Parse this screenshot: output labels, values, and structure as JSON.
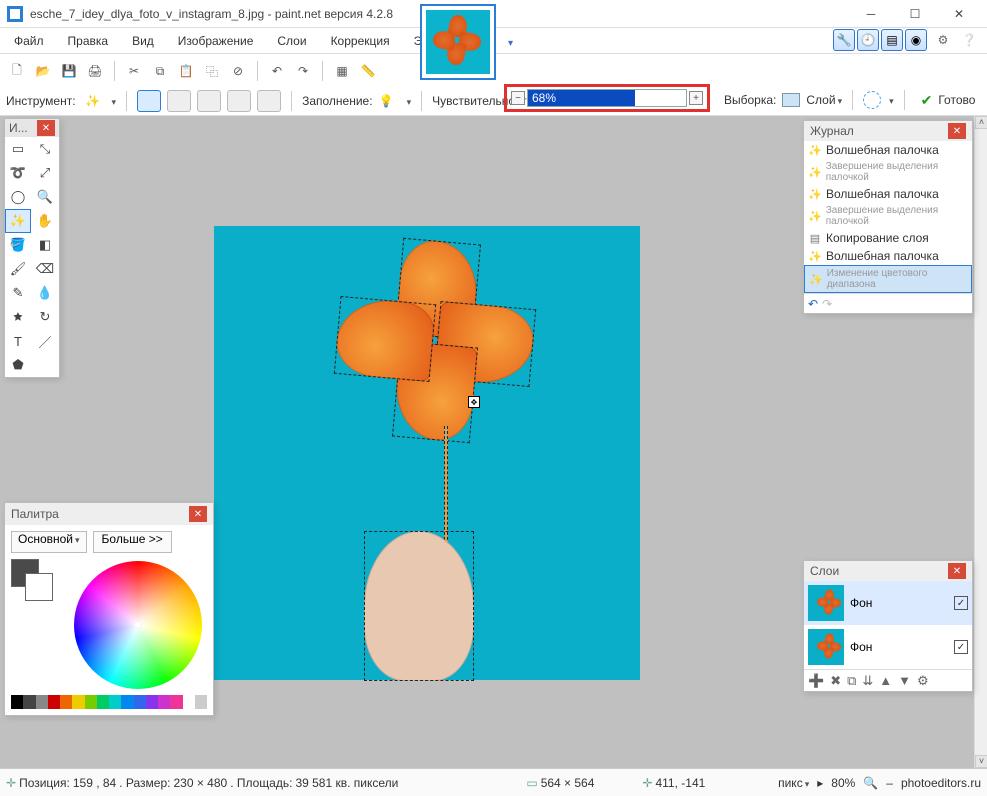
{
  "title": "esche_7_idey_dlya_foto_v_instagram_8.jpg - paint.net версия 4.2.8",
  "menu": {
    "file": "Файл",
    "edit": "Правка",
    "view": "Вид",
    "image": "Изображение",
    "layers": "Слои",
    "adjust": "Коррекция",
    "effects": "Эффекты"
  },
  "toolbar2": {
    "instrument_label": "Инструмент:",
    "fill_label": "Заполнение:",
    "tolerance_label": "Чувствительность:",
    "tolerance_value": "68%",
    "sampling_label": "Выборка:",
    "sampling_value": "Слой",
    "ready_label": "Готово"
  },
  "tools_window": {
    "title": "И..."
  },
  "palette": {
    "title": "Палитра",
    "mode": "Основной",
    "more": "Больше >>",
    "strip": [
      "#000",
      "#444",
      "#888",
      "#c00",
      "#e60",
      "#ec0",
      "#7c0",
      "#0c6",
      "#0cc",
      "#08e",
      "#36e",
      "#83e",
      "#c3c",
      "#e39",
      "#fff",
      "#ccc"
    ]
  },
  "history": {
    "title": "Журнал",
    "items": [
      {
        "label": "Волшебная палочка",
        "small": false
      },
      {
        "label": "Завершение выделения палочкой",
        "small": true
      },
      {
        "label": "Волшебная палочка",
        "small": false
      },
      {
        "label": "Завершение выделения палочкой",
        "small": true
      },
      {
        "label": "Копирование слоя",
        "small": false,
        "icon": "layer"
      },
      {
        "label": "Волшебная палочка",
        "small": false
      },
      {
        "label": "Изменение цветового диапазона",
        "small": true,
        "sel": true
      }
    ]
  },
  "layers": {
    "title": "Слои",
    "items": [
      {
        "name": "Фон",
        "checked": true,
        "sel": true
      },
      {
        "name": "Фон",
        "checked": true,
        "sel": false
      }
    ]
  },
  "status": {
    "pos_label": "Позиция:",
    "pos_value": "159 , 84",
    "size_label": ". Размер:",
    "size_value": "230   × 480",
    "area_label": ". Площадь:",
    "area_value": "39 581 кв. пиксели",
    "dim": "564 × 564",
    "offset": "411, -141",
    "unit": "пикс",
    "zoom": "80%",
    "site": "photoeditors.ru"
  }
}
